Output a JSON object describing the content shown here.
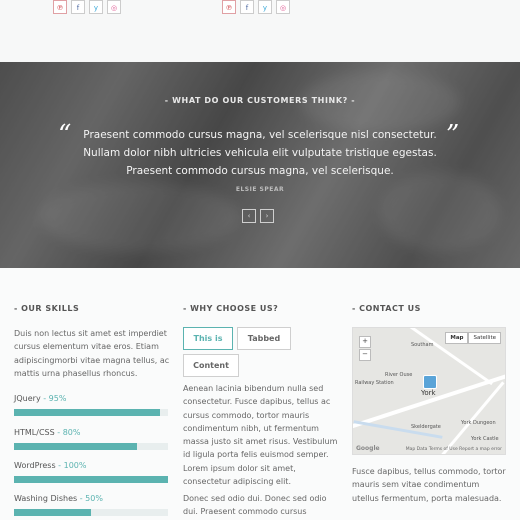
{
  "social": {
    "icons": [
      "pinterest-icon",
      "facebook-icon",
      "twitter-icon",
      "dribbble-icon"
    ],
    "glyphs": [
      "℗",
      "f",
      "y",
      "◎"
    ]
  },
  "testimonials": {
    "title": "- WHAT DO OUR CUSTOMERS THINK? -",
    "quote_open": "“",
    "quote_close": "”",
    "text": "Praesent commodo cursus magna, vel scelerisque nisl consectetur. Nullam dolor nibh ultricies vehicula elit vulputate tristique egestas. Praesent commodo cursus magna, vel scelerisque.",
    "author": "ELSIE SPEAR",
    "prev": "‹",
    "next": "›"
  },
  "skills": {
    "title": "- OUR SKILLS",
    "intro": "Duis non lectus sit amet est imperdiet cursus elementum vitae eros. Etiam adipiscingmorbi vitae magna tellus, ac mattis urna phasellus rhoncus.",
    "items": [
      {
        "name": "JQuery",
        "percent_label": "95%",
        "level": 0.95
      },
      {
        "name": "HTML/CSS",
        "percent_label": "80%",
        "level": 0.8
      },
      {
        "name": "WordPress",
        "percent_label": "100%",
        "level": 1.0
      },
      {
        "name": "Washing Dishes",
        "percent_label": "50%",
        "level": 0.5
      }
    ],
    "separator": " - "
  },
  "why": {
    "title": "- WHY CHOOSE US?",
    "tabs": [
      "This is",
      "Tabbed",
      "Content"
    ],
    "active_tab": 0,
    "para1": "Aenean lacinia bibendum nulla sed consectetur. Fusce dapibus, tellus ac cursus commodo, tortor mauris condimentum nibh, ut fermentum massa justo sit amet risus. Vestibulum id ligula porta felis euismod semper. Lorem ipsum dolor sit amet, consectetur adipiscing elit.",
    "para2": "Donec sed odio dui. Donec sed odio dui. Praesent commodo cursus"
  },
  "contact": {
    "title": "- CONTACT US",
    "map": {
      "type_map": "Map",
      "type_satellite": "Satellite",
      "zoom_in": "+",
      "zoom_out": "−",
      "labels": [
        "Railway Station",
        "River Ouse",
        "York",
        "York Dungeon",
        "Southam",
        "Skeldergate",
        "York Castle"
      ],
      "footer": "Map Data   Terms of Use   Report a map error",
      "brand": "Google"
    },
    "text": "Fusce dapibus, tellus commodo, tortor mauris sem vitae condimentum utellus fermentum, porta malesuada."
  },
  "colors": {
    "accent": "#5bb3b0",
    "band_text": "#ffffff"
  }
}
